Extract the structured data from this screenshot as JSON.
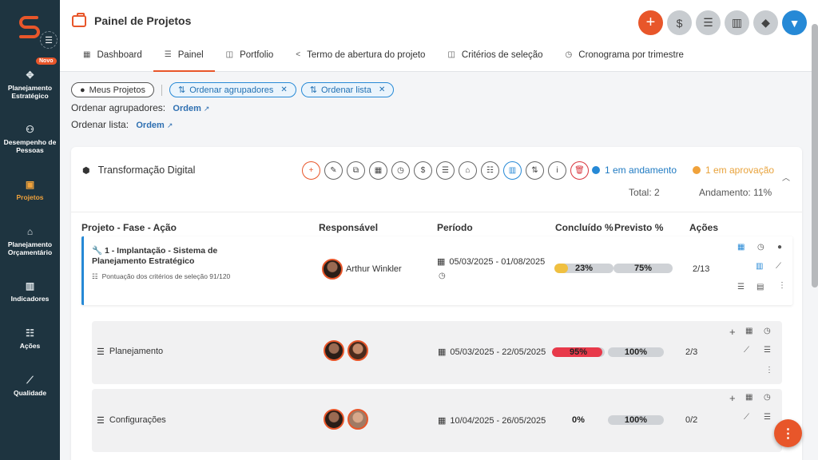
{
  "sidebar": {
    "badge": "Novo",
    "items": [
      {
        "label": "Planejamento Estratégico",
        "icon": "puzzle-icon"
      },
      {
        "label": "Desempenho de Pessoas",
        "icon": "people-icon"
      },
      {
        "label": "Projetos",
        "icon": "briefcase-icon"
      },
      {
        "label": "Planejamento Orçamentário",
        "icon": "bank-icon"
      },
      {
        "label": "Indicadores",
        "icon": "bar-chart-icon"
      },
      {
        "label": "Ações",
        "icon": "checklist-icon"
      },
      {
        "label": "Qualidade",
        "icon": "line-chart-icon"
      }
    ]
  },
  "header": {
    "title": "Painel de Projetos",
    "tabs": [
      "Dashboard",
      "Painel",
      "Portfolio",
      "Termo de abertura do projeto",
      "Critérios de seleção",
      "Cronograma por trimestre"
    ]
  },
  "filters": {
    "chip1": "Meus Projetos",
    "chip2": "Ordenar agrupadores",
    "chip3": "Ordenar lista",
    "ord1_label": "Ordenar agrupadores:",
    "ord1_value": "Ordem",
    "ord2_label": "Ordenar lista:",
    "ord2_value": "Ordem"
  },
  "group": {
    "name": "Transformação Digital",
    "status1": "1 em andamento",
    "status2": "1 em aprovação",
    "total": "Total: 2",
    "andamento": "Andamento: 11%"
  },
  "columns": [
    "Projeto - Fase - Ação",
    "Responsável",
    "Período",
    "Concluído %",
    "Previsto %",
    "Ações"
  ],
  "project": {
    "title": "1 - Implantação - Sistema de Planejamento Estratégico",
    "criteria": "Pontuação dos critérios de seleção 91/120",
    "responsible": "Arthur Winkler",
    "period": "05/03/2025 - 01/08/2025",
    "done": "23%",
    "done_value": 23,
    "planned": "75%",
    "planned_value": 75,
    "actions": "2/13"
  },
  "phases": [
    {
      "name": "Planejamento",
      "period": "05/03/2025 - 22/05/2025",
      "done": "95%",
      "done_value": 95,
      "planned": "100%",
      "planned_value": 100,
      "actions": "2/3"
    },
    {
      "name": "Configurações",
      "period": "10/04/2025 - 26/05/2025",
      "done": "0%",
      "done_value": 0,
      "planned": "100%",
      "planned_value": 100,
      "actions": "0/2"
    }
  ],
  "colors": {
    "accent": "#e8562a",
    "blue": "#2689d6",
    "yellow": "#f0c040",
    "red": "#e8394a",
    "sidebar": "#1e3440"
  }
}
